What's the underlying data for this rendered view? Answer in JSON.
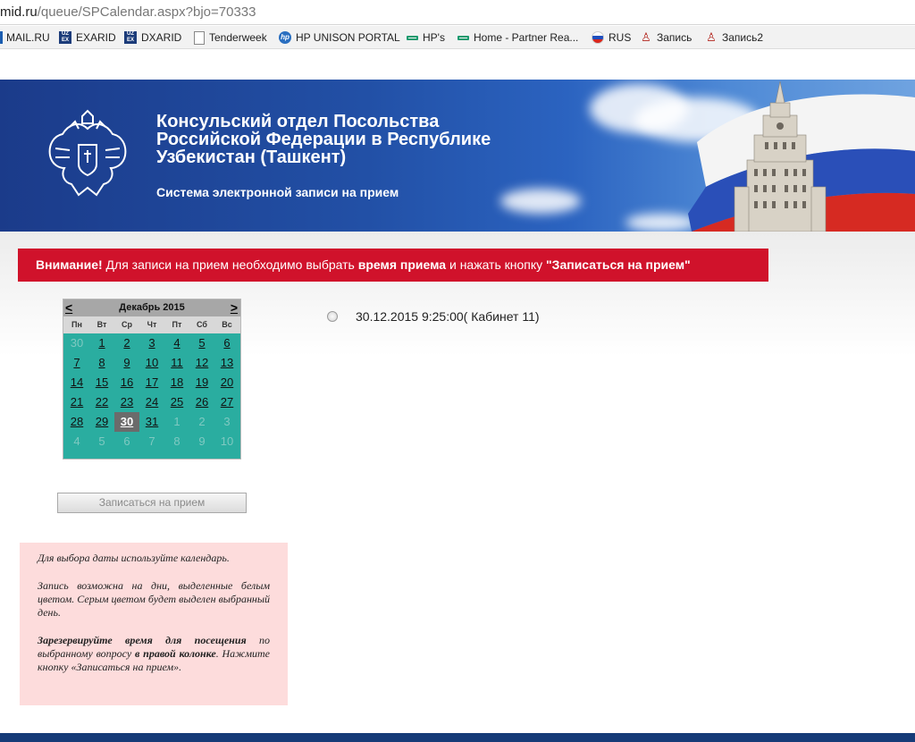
{
  "browser": {
    "url_host": "mid.ru",
    "url_path": "/queue/SPCalendar.aspx?bjo=70333",
    "bookmarks": [
      {
        "label": "MAIL.RU",
        "icon": "mailru-icon"
      },
      {
        "label": "EXARID",
        "icon": "uzex-icon"
      },
      {
        "label": "DXARID",
        "icon": "uzex-icon"
      },
      {
        "label": "Tenderweek",
        "icon": "page-icon"
      },
      {
        "label": "HP UNISON PORTAL",
        "icon": "hp-icon"
      },
      {
        "label": "HP's",
        "icon": "hpe-icon"
      },
      {
        "label": "Home - Partner Rea...",
        "icon": "hpe-icon"
      },
      {
        "label": "RUS",
        "icon": "russia-flag-icon"
      },
      {
        "label": "Запись",
        "icon": "people-icon"
      },
      {
        "label": "Запись2",
        "icon": "people-icon"
      }
    ]
  },
  "banner": {
    "title": "Консульский отдел Посольства Российской Федерации в Республике Узбекистан (Ташкент)",
    "subtitle": "Система электронной записи на прием"
  },
  "alert": {
    "strong1": "Внимание!",
    "text1": " Для записи на прием необходимо выбрать ",
    "strong2": "время приема",
    "text2": " и нажать кнопку ",
    "strong3": "\"Записаться на прием\""
  },
  "calendar": {
    "month_title": "Декабрь 2015",
    "prev_label": "<",
    "next_label": ">",
    "weekdays": [
      "Пн",
      "Вт",
      "Ср",
      "Чт",
      "Пт",
      "Сб",
      "Вс"
    ],
    "days": [
      "30",
      "1",
      "2",
      "3",
      "4",
      "5",
      "6",
      "7",
      "8",
      "9",
      "10",
      "11",
      "12",
      "13",
      "14",
      "15",
      "16",
      "17",
      "18",
      "19",
      "20",
      "21",
      "22",
      "23",
      "24",
      "25",
      "26",
      "27",
      "28",
      "29",
      "30",
      "31",
      "1",
      "2",
      "3",
      "4",
      "5",
      "6",
      "7",
      "8",
      "9",
      "10"
    ],
    "selected_day": "30",
    "colors": {
      "available": "#2aada0",
      "header": "#a7a7a7",
      "selected": "#6b6b6b"
    }
  },
  "book_button_label": "Записаться на прием",
  "slot": {
    "label": "30.12.2015 9:25:00( Кабинет 11)",
    "selected": false
  },
  "info": {
    "p1": "Для выбора даты используйте календарь.",
    "p2": "Запись возможна на дни, выделенные белым цветом. Серым цветом будет выделен выбранный день.",
    "p3_strong": "Зарезервируйте время для посещения",
    "p3_text1": " по выбранному вопросу ",
    "p3_strong2": "в правой колонке",
    "p3_text2": ". Нажмите кнопку «Записаться на прием»."
  }
}
